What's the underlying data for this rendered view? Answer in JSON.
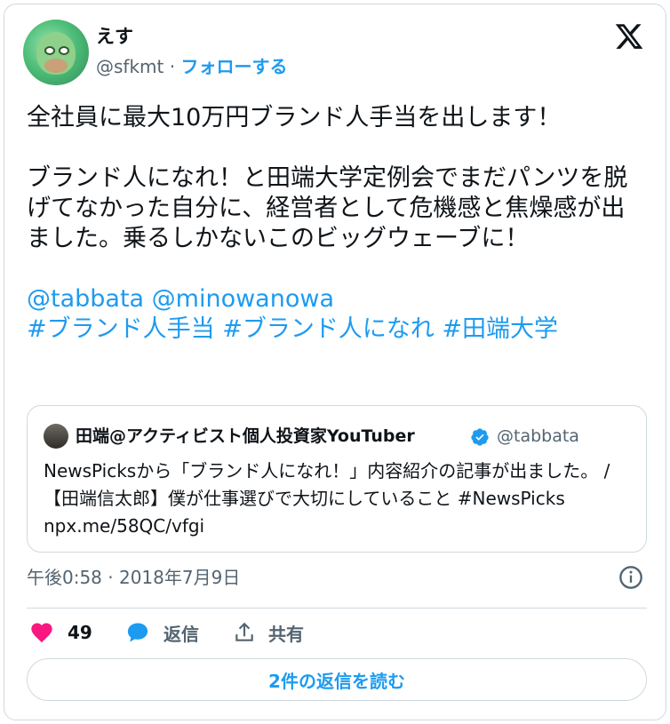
{
  "author": {
    "name": "えす",
    "handle": "@sfkmt",
    "separator": " · ",
    "follow_label": "フォローする"
  },
  "tweet": {
    "para1": "全社員に最大10万円ブランド人手当を出します！",
    "para2": "ブランド人になれ！と田端大学定例会でまだパンツを脱げてなかった自分に、経営者として危機感と焦燥感が出ました。乗るしかないこのビッグウェーブに！",
    "mentions": "@tabbata @minowanowa",
    "hashtags": "#ブランド人手当 #ブランド人になれ #田端大学"
  },
  "quote": {
    "name": "田端@アクティビスト個人投資家YouTuber",
    "handle": "@tabbata",
    "text": "NewsPicksから「ブランド人になれ！」内容紹介の記事が出ました。 / 【田端信太郎】僕が仕事選びで大切にしていること #NewsPicks npx.me/58QC/vfgi"
  },
  "timestamp": "午後0:58 · 2018年7月9日",
  "actions": {
    "like_count": "49",
    "reply_label": "返信",
    "share_label": "共有"
  },
  "read_replies_label": "2件の返信を読む",
  "colors": {
    "accent": "#1d9bf0",
    "like": "#f91880",
    "text": "#0f1419",
    "secondary": "#536471",
    "border": "#cfd9de"
  },
  "icons": [
    "x-logo-icon",
    "verified-badge-icon",
    "info-icon",
    "heart-icon",
    "reply-bubble-icon",
    "share-icon"
  ]
}
